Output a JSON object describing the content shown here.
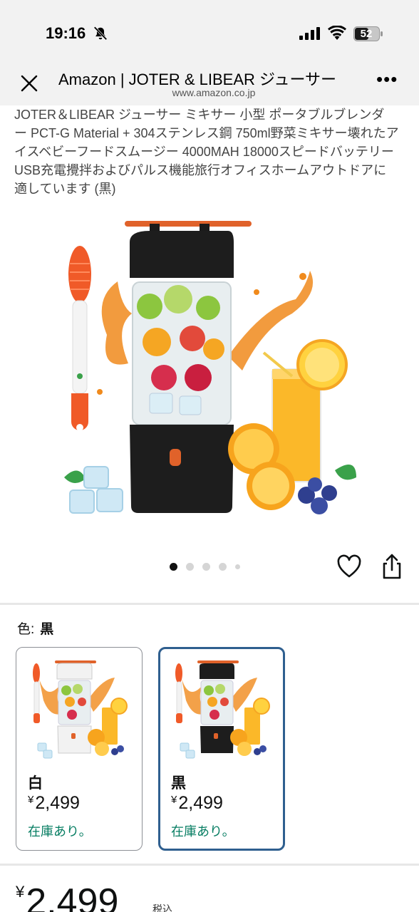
{
  "status_bar": {
    "time": "19:16",
    "battery": "52",
    "icons": [
      "bell-slash-icon",
      "signal-icon",
      "wifi-icon",
      "battery-icon"
    ]
  },
  "browser": {
    "title": "Amazon | JOTER & LIBEAR ジューサー",
    "url": "www.amazon.co.jp",
    "more": "•••",
    "icons": [
      "close-icon",
      "more-icon"
    ]
  },
  "product": {
    "title": "JOTER＆LIBEAR ジューサー ミキサー 小型 ポータブルブレンダ ー PCT-G Material + 304ステンレス鋼 750ml野菜ミキサー壊れたアイスベビーフードスムージー 4000MAH 18000スピードバッテリーUSB充電攪拌およびパルス機能旅行オフィスホームアウトドアに適しています (黒)",
    "carousel_count": 5,
    "carousel_active": 0,
    "icons": [
      "heart-icon",
      "share-icon"
    ]
  },
  "variation": {
    "label": "色:",
    "selected": "黒",
    "options": [
      {
        "name": "白",
        "currency": "¥",
        "price": "2,499",
        "stock": "在庫あり。"
      },
      {
        "name": "黒",
        "currency": "¥",
        "price": "2,499",
        "stock": "在庫あり。"
      }
    ]
  },
  "price": {
    "currency": "¥",
    "amount": "2,499",
    "tax": "税込"
  },
  "colors": {
    "in_stock": "#067d62",
    "selected_border": "#2f5f8f",
    "accent_orange": "#e0622a"
  }
}
